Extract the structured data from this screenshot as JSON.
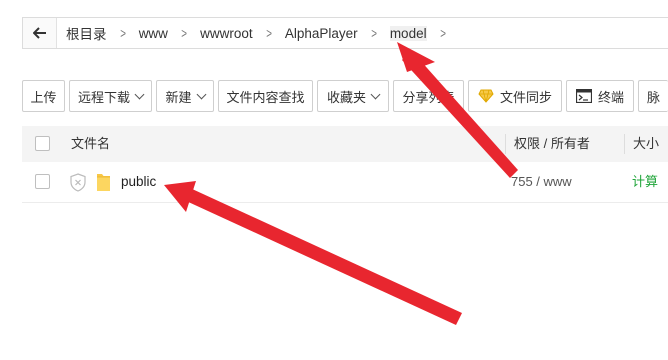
{
  "breadcrumb": {
    "items": [
      "根目录",
      "www",
      "wwwroot",
      "AlphaPlayer",
      "model"
    ]
  },
  "toolbar": {
    "upload": "上传",
    "remote_download": "远程下载",
    "new": "新建",
    "content_search": "文件内容查找",
    "favorites": "收藏夹",
    "share_list": "分享列表",
    "file_sync": "文件同步",
    "terminal": "终端",
    "partial": "脉"
  },
  "table": {
    "headers": {
      "name": "文件名",
      "perm": "权限 / 所有者",
      "size": "大小"
    },
    "rows": [
      {
        "name": "public",
        "perm": "755 / www",
        "size": "计算"
      }
    ]
  },
  "colors": {
    "accent": "#20a53a",
    "arrow": "#e8262f"
  }
}
